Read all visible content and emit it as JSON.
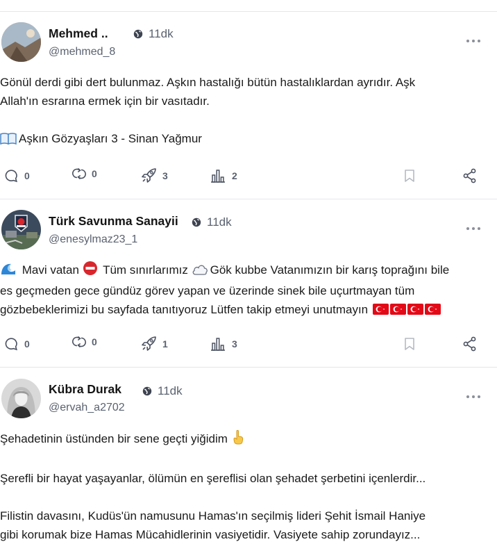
{
  "posts": [
    {
      "author": "Mehmed ..",
      "handle": "@mehmed_8",
      "time": "11dk",
      "lines": [
        "Gönül derdi gibi dert bulunmaz. Aşkın hastalığı bütün hastalıklardan  ayrıdır. Aşk",
        "Allah'ın esrarına ermek için bir vasıtadır.",
        "",
        "Aşkın Gözyaşları 3 - Sinan Yağmur"
      ],
      "stats": {
        "comments": "0",
        "reposts": "0",
        "boosts": "3",
        "views": "2"
      }
    },
    {
      "author": "Türk Savunma Sanayii",
      "handle": "@enesylmaz23_1",
      "time": "11dk",
      "lines": [
        " Mavi vatan ",
        " Tüm sınırlarımız ",
        "Gök kubbe Vatanımızın bir karış toprağını bile",
        "es geçmeden gece gündüz görev yapan ve üzerinde sinek bile uçurtmayan tüm",
        "gözbebeklerimizi bu sayfada tanıtıyoruz Lütfen takip etmeyi unutmayın "
      ],
      "stats": {
        "comments": "0",
        "reposts": "0",
        "boosts": "1",
        "views": "3"
      }
    },
    {
      "author": "Kübra Durak",
      "handle": "@ervah_a2702",
      "time": "11dk",
      "lines": [
        "Şehadetinin üstünden bir sene geçti yiğidim ",
        "",
        "Şerefli bir hayat yaşayanlar, ölümün en şereflisi olan şehadet şerbetini içenlerdir...",
        "",
        "Filistin davasını, Kudüs'ün namusunu Hamas'ın seçilmiş lideri Şehit İsmail Haniye",
        "gibi korumak bize Hamas Mücahidlerinin vasiyetidir. Vasiyete sahip zorundayız..."
      ]
    }
  ],
  "icons": {
    "book": "📖",
    "wave": "🌊",
    "no_entry": "⛔",
    "cloud": "☁",
    "finger": "☝"
  },
  "colors": {
    "accent": "#5a6270",
    "divider": "#e6e6ec",
    "flag": "#e30a17"
  }
}
